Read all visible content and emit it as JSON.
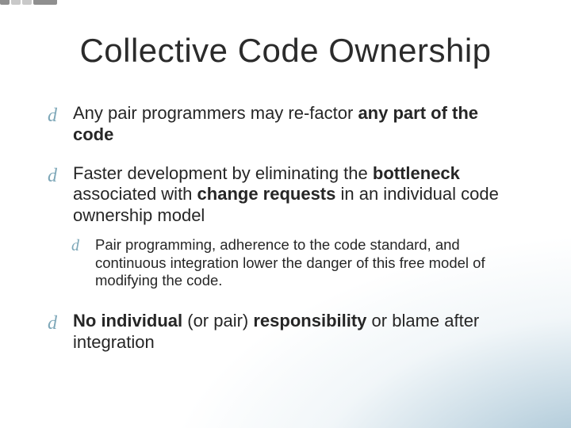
{
  "title": "Collective Code Ownership",
  "bullet_glyph": "d",
  "bullets": [
    {
      "level": 0,
      "html": "Any pair programmers may re-factor <b>any part of the code</b>"
    },
    {
      "level": 0,
      "html": "Faster development by eliminating the <b>bottleneck</b> associated with <b>change requests</b> in an individual code ownership model"
    },
    {
      "level": 1,
      "html": "Pair programming, adherence to the code standard, and continuous integration lower the danger of this free model of modifying the code."
    },
    {
      "level": 0,
      "html": "<b>No individual</b> (or pair) <b>responsibility</b> or blame after integration"
    }
  ]
}
